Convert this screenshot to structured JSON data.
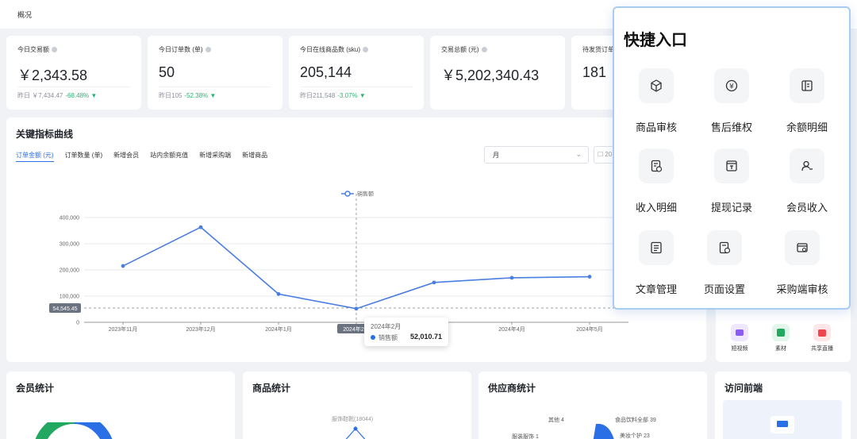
{
  "breadcrumb": "概况",
  "stats": [
    {
      "title": "今日交易额",
      "value": "￥2,343.58",
      "sub": "昨日 ￥7,434.47",
      "pct": "-68.48% ▼"
    },
    {
      "title": "今日订单数 (单)",
      "value": "50",
      "sub": "昨日105",
      "pct": "-52.38% ▼"
    },
    {
      "title": "今日在线商品数 (sku)",
      "value": "205,144",
      "sub": "昨日211,548",
      "pct": "-3.07% ▼"
    },
    {
      "title": "交易总额 (元)",
      "value": "￥5,202,340.43"
    },
    {
      "title": "待发货订单",
      "value": "181"
    }
  ],
  "metrics": {
    "title": "关键指标曲线",
    "tabs": [
      "订单金额 (元)",
      "订单数量 (单)",
      "新增会员",
      "站内余额充值",
      "新增采购端",
      "新增商品"
    ],
    "period_select": "月",
    "date_partial": "20"
  },
  "chart_data": {
    "type": "line",
    "legend": "销售额",
    "categories": [
      "2023年11月",
      "2023年12月",
      "2024年1月",
      "2024年2月",
      "2024年3月",
      "2024年4月",
      "2024年5月"
    ],
    "series": [
      {
        "name": "销售额",
        "values": [
          215000,
          363000,
          108000,
          52010.71,
          152000,
          170000,
          174000
        ]
      }
    ],
    "y_ticks": [
      "400,000",
      "300,000",
      "200,000",
      "100,000",
      "0"
    ],
    "ylim": [
      0,
      400000
    ],
    "crosshair_label": "54,545.45",
    "tooltip": {
      "title": "2024年2月",
      "series": "销售额",
      "value": "52,010.71"
    },
    "color": "#4a7ee0"
  },
  "quick": {
    "title": "快捷入口",
    "items": [
      {
        "label": "商品审核",
        "icon": "cube-icon"
      },
      {
        "label": "售后维权",
        "icon": "yuan-refund-icon"
      },
      {
        "label": "余额明细",
        "icon": "wallet-icon"
      },
      {
        "label": "收入明细",
        "icon": "income-doc-icon"
      },
      {
        "label": "提现记录",
        "icon": "withdraw-icon"
      },
      {
        "label": "会员收入",
        "icon": "member-icon"
      },
      {
        "label": "文章管理",
        "icon": "article-icon"
      },
      {
        "label": "页面设置",
        "icon": "page-settings-icon"
      },
      {
        "label": "采购端审核",
        "icon": "purchase-audit-icon"
      }
    ]
  },
  "mini_apps": [
    {
      "label": "短视频",
      "color": "#8b5cf6"
    },
    {
      "label": "素材",
      "color": "#22a860"
    },
    {
      "label": "共享直播",
      "color": "#f0444f"
    }
  ],
  "bottom": {
    "member": "会员统计",
    "product": "商品统计",
    "product_chart_label": "服饰鞋靴(18044)",
    "supplier": "供应商统计",
    "supplier_labels": [
      "其他 4",
      "服装服饰 1",
      "食品饮料全部 39",
      "美妆个护 23"
    ],
    "visit": "访问前端"
  }
}
